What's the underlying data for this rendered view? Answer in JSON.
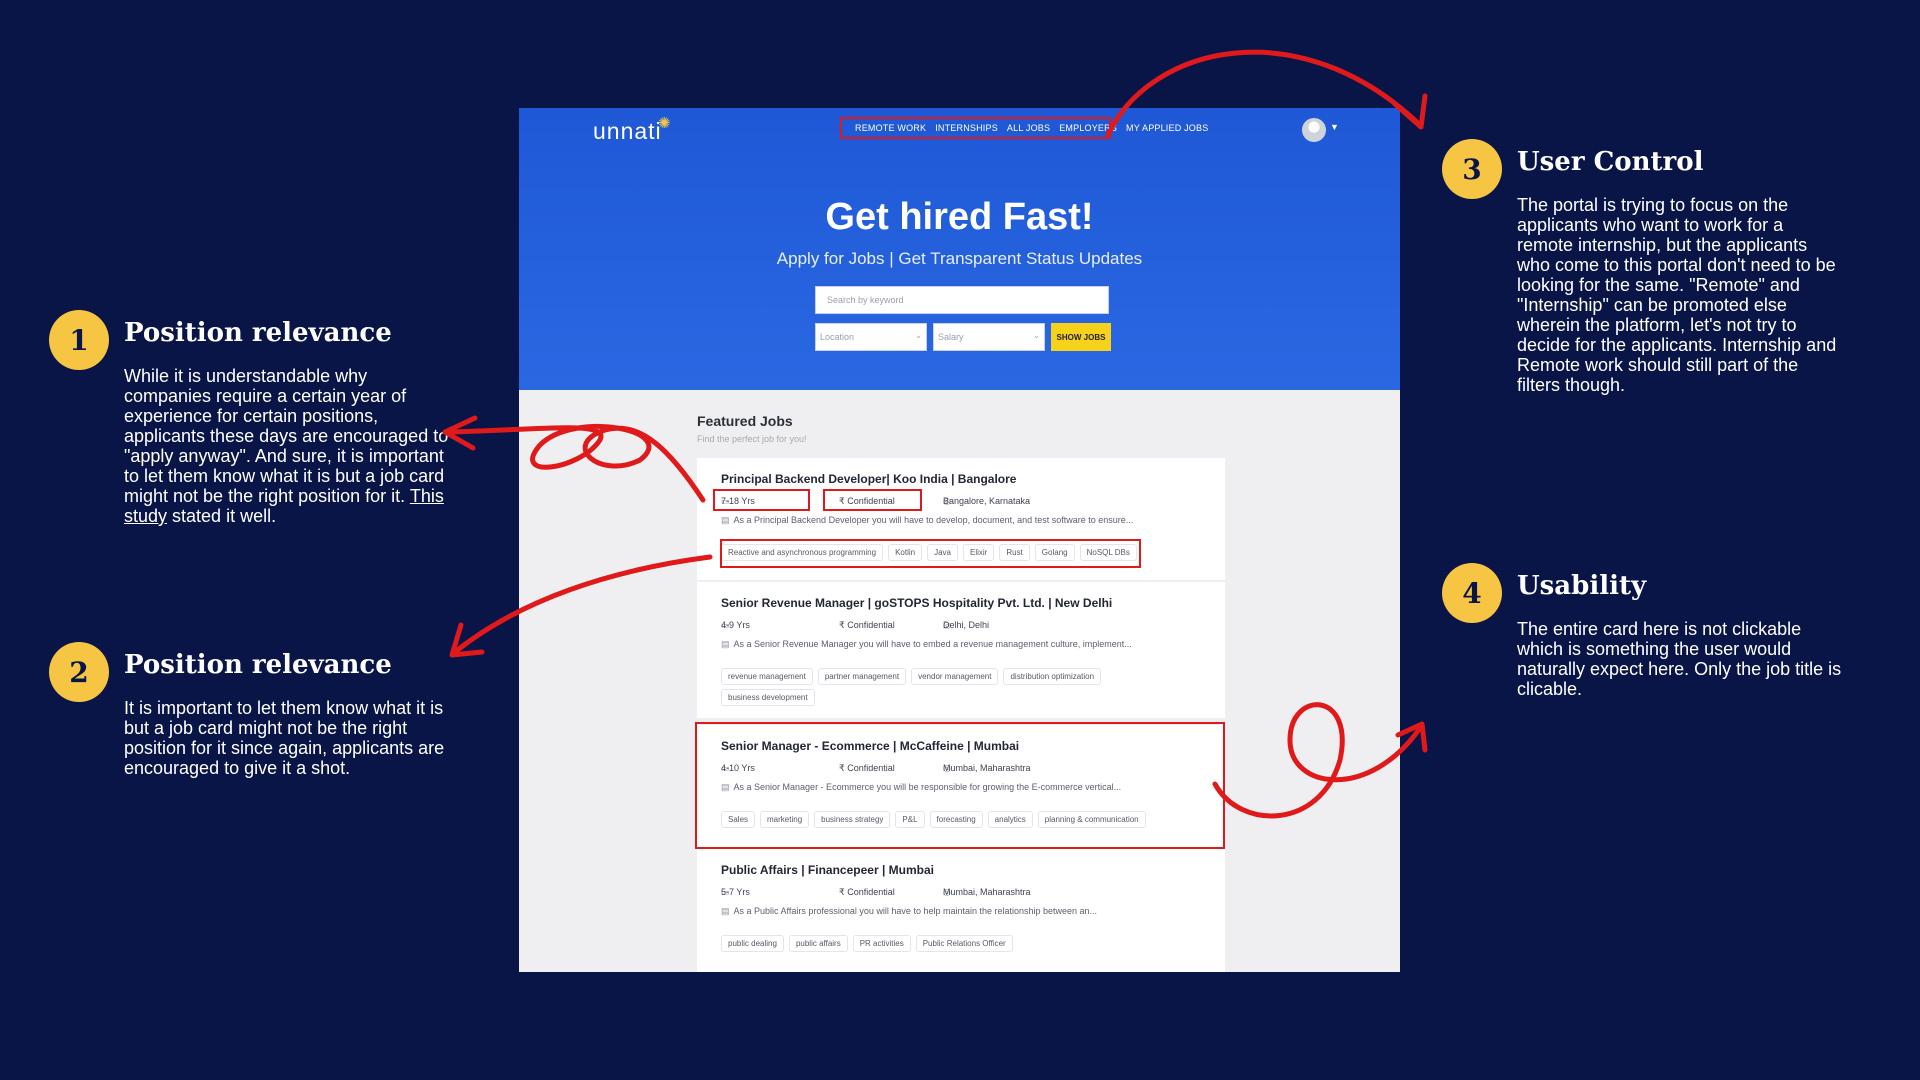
{
  "notes": [
    {
      "num": "1",
      "title": "Position relevance",
      "body": "While it is understandable why companies require a certain year of experience for certain positions, applicants these days are encouraged to \"apply anyway\". And sure, it is important to let them know what it is but a job card might not be the right position for it.",
      "link1": "This",
      "link2": "study",
      "tail": " stated it well."
    },
    {
      "num": "2",
      "title": "Position relevance",
      "body": "It is important to let them know what it is but a job card might not be the right position for it since again, applicants are encouraged to give it a shot."
    },
    {
      "num": "3",
      "title": "User Control",
      "body": "The portal is trying to focus on the applicants who want to work for a remote internship, but the applicants who come to this portal don't need to be looking for the same. \"Remote\" and \"Internship\" can be promoted else wherein the platform, let's not try to decide for the applicants. Internship and Remote work should still part of the filters though."
    },
    {
      "num": "4",
      "title": "Usability",
      "body": "The entire card here is not clickable which is something the user would naturally expect here. Only the job title is clicable."
    }
  ],
  "app": {
    "logo": "unnati",
    "nav": [
      "REMOTE WORK",
      "INTERNSHIPS",
      "ALL JOBS",
      "EMPLOYERS",
      "MY APPLIED JOBS"
    ],
    "hero_title": "Get hired Fast!",
    "hero_sub": "Apply for Jobs | Get Transparent Status Updates",
    "search_placeholder": "Search by keyword",
    "location_placeholder": "Location",
    "salary_placeholder": "Salary",
    "show_jobs": "SHOW JOBS",
    "featured_title": "Featured Jobs",
    "featured_sub": "Find the perfect job for you!"
  },
  "jobs": [
    {
      "title": "Principal Backend Developer| Koo India | Bangalore",
      "exp": "7-18 Yrs",
      "salary": "₹ Confidential",
      "location": "Bangalore, Karnataka",
      "desc": "As a Principal Backend Developer you will have to develop, document, and test software to ensure...",
      "tags": [
        "Reactive and asynchronous programming",
        "Kotlin",
        "Java",
        "Elixir",
        "Rust",
        "Golang",
        "NoSQL DBs"
      ]
    },
    {
      "title": "Senior Revenue Manager | goSTOPS Hospitality Pvt. Ltd. | New Delhi",
      "exp": "4-9 Yrs",
      "salary": "₹ Confidential",
      "location": "Delhi, Delhi",
      "desc": "As a Senior Revenue Manager you will have to  embed a revenue management culture, implement...",
      "tags": [
        "revenue management",
        "partner management",
        "vendor management",
        "distribution optimization",
        "business development"
      ]
    },
    {
      "title": "Senior Manager - Ecommerce | McCaffeine | Mumbai",
      "exp": "4-10 Yrs",
      "salary": "₹ Confidential",
      "location": "Mumbai, Maharashtra",
      "desc": "As a Senior Manager - Ecommerce you will be responsible for growing the E-commerce vertical...",
      "tags": [
        "Sales",
        "marketing",
        "business strategy",
        "P&L",
        "forecasting",
        "analytics",
        "planning & communication"
      ]
    },
    {
      "title": "Public Affairs | Financepeer | Mumbai",
      "exp": "5-7 Yrs",
      "salary": "₹ Confidential",
      "location": "Mumbai, Maharashtra",
      "desc": "As a Public Affairs professional you will have to help maintain the relationship between an...",
      "tags": [
        "public dealing",
        "public affairs",
        "PR activities",
        "Public Relations Officer"
      ]
    }
  ],
  "colors": {
    "background": "#0a1547",
    "accent": "#f6c544",
    "highlight": "#e01a1a",
    "hero": "#2563e0"
  }
}
